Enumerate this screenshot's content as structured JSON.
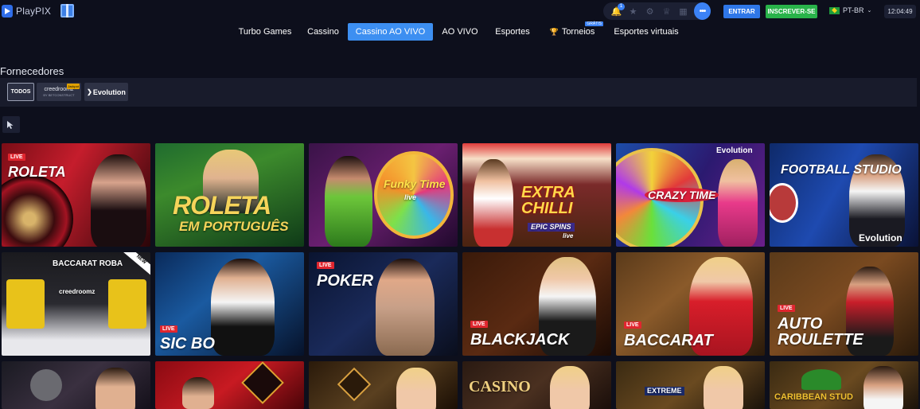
{
  "header": {
    "logo_text": "PlayPIX",
    "notification_count": "1",
    "login_label": "ENTRAR",
    "signup_label": "INSCREVER-SE",
    "language": "PT-BR",
    "clock": "12:04:49"
  },
  "nav": {
    "items": [
      {
        "label": "Turbo Games"
      },
      {
        "label": "Cassino"
      },
      {
        "label": "Cassino AO VIVO"
      },
      {
        "label": "AO VIVO"
      },
      {
        "label": "Esportes"
      },
      {
        "label": "Torneios",
        "badge": "GRÁTIS"
      },
      {
        "label": "Esportes virtuais"
      }
    ],
    "active_index": 2
  },
  "providers": {
    "title": "Fornecedores",
    "items": [
      {
        "label": "TODOS"
      },
      {
        "label": "creedroomz",
        "sub": "BY BETCONSTRUCT",
        "badge": "Jackpot"
      },
      {
        "label": "Evolution"
      }
    ]
  },
  "colors": {
    "accent": "#3d8ff1",
    "live_badge": "#e0262f",
    "signup": "#29b34a",
    "background": "#0d0f1c"
  },
  "games": [
    {
      "title": "ROLETA",
      "live": "LIVE"
    },
    {
      "title": "ROLETA",
      "subtitle": "EM PORTUGUÊS"
    },
    {
      "title": "Funky Time",
      "subtitle": "live"
    },
    {
      "title": "EXTRA CHILLI",
      "subtitle": "EPIC SPINS",
      "tag": "live"
    },
    {
      "title": "CRAZY TIME",
      "provider": "Evolution"
    },
    {
      "title": "FOOTBALL STUDIO",
      "provider": "Evolution"
    },
    {
      "title": "BACCARAT ROBA",
      "subtitle": "creedroomz",
      "badge": "NEW"
    },
    {
      "title": "SIC BO",
      "live": "LIVE"
    },
    {
      "title": "POKER",
      "live": "LIVE"
    },
    {
      "title": "BLACKJACK",
      "live": "LIVE"
    },
    {
      "title": "BACCARAT",
      "live": "LIVE"
    },
    {
      "title": "AUTO ROULETTE",
      "live": "LIVE"
    },
    {
      "title": ""
    },
    {
      "title": ""
    },
    {
      "title": ""
    },
    {
      "title": "CASINO"
    },
    {
      "title": "EXTREME"
    },
    {
      "title": "CARIBBEAN STUD"
    }
  ]
}
